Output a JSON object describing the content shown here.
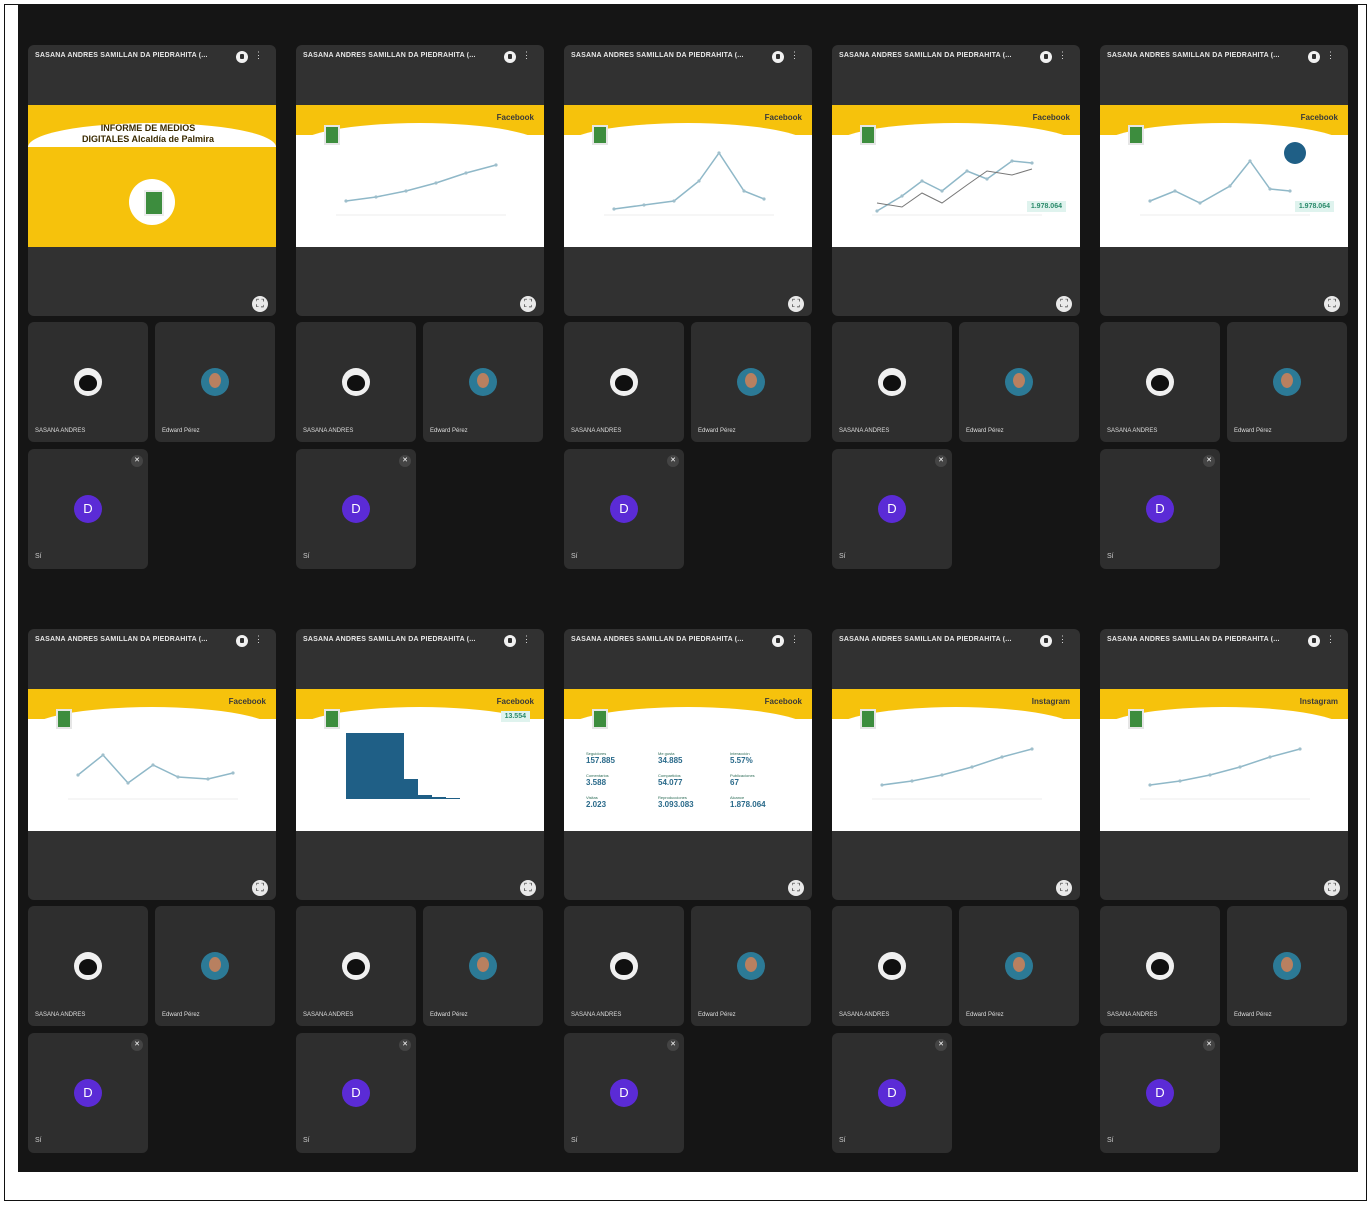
{
  "share_title": "SASANA ANDRES SAMILLAN DA PIEDRAHITA (...",
  "cover": {
    "title": "INFORME DE MEDIOS DIGITALES Alcaldía de Palmira"
  },
  "network_labels": {
    "facebook": "Facebook",
    "instagram": "Instagram"
  },
  "participants": {
    "p1": "SASANA ANDRES",
    "p2": "Edward Pérez",
    "p3_initial": "D",
    "p3_label": "Sí"
  },
  "expand_icon_glyph": "⛶",
  "stats_slide": {
    "heading": "Facebook",
    "items": [
      {
        "label": "Seguidores",
        "value": "157.885"
      },
      {
        "label": "Me gusta",
        "value": "34.885"
      },
      {
        "label": "Interacción",
        "value": "5.57%"
      },
      {
        "label": "Comentarios",
        "value": "3.588"
      },
      {
        "label": "Compartidos",
        "value": "54.077"
      },
      {
        "label": "Publicaciones",
        "value": "67"
      },
      {
        "label": "Visitas",
        "value": "2.023"
      },
      {
        "label": "Reproducciones",
        "value": "3.093.083"
      },
      {
        "label": "Alcance",
        "value": "1.878.064"
      }
    ]
  },
  "highlight_values": {
    "slide4": "1.978.064",
    "slide5": "1.978.064",
    "slide7": "13.554"
  },
  "icon_colors": {
    "accent_yellow": "#f6c20c",
    "logo_green": "#3d8d3e",
    "avatar_purple": "#5b2bd6",
    "dark_bg": "#151515",
    "tile_bg": "#2e2e2e"
  }
}
